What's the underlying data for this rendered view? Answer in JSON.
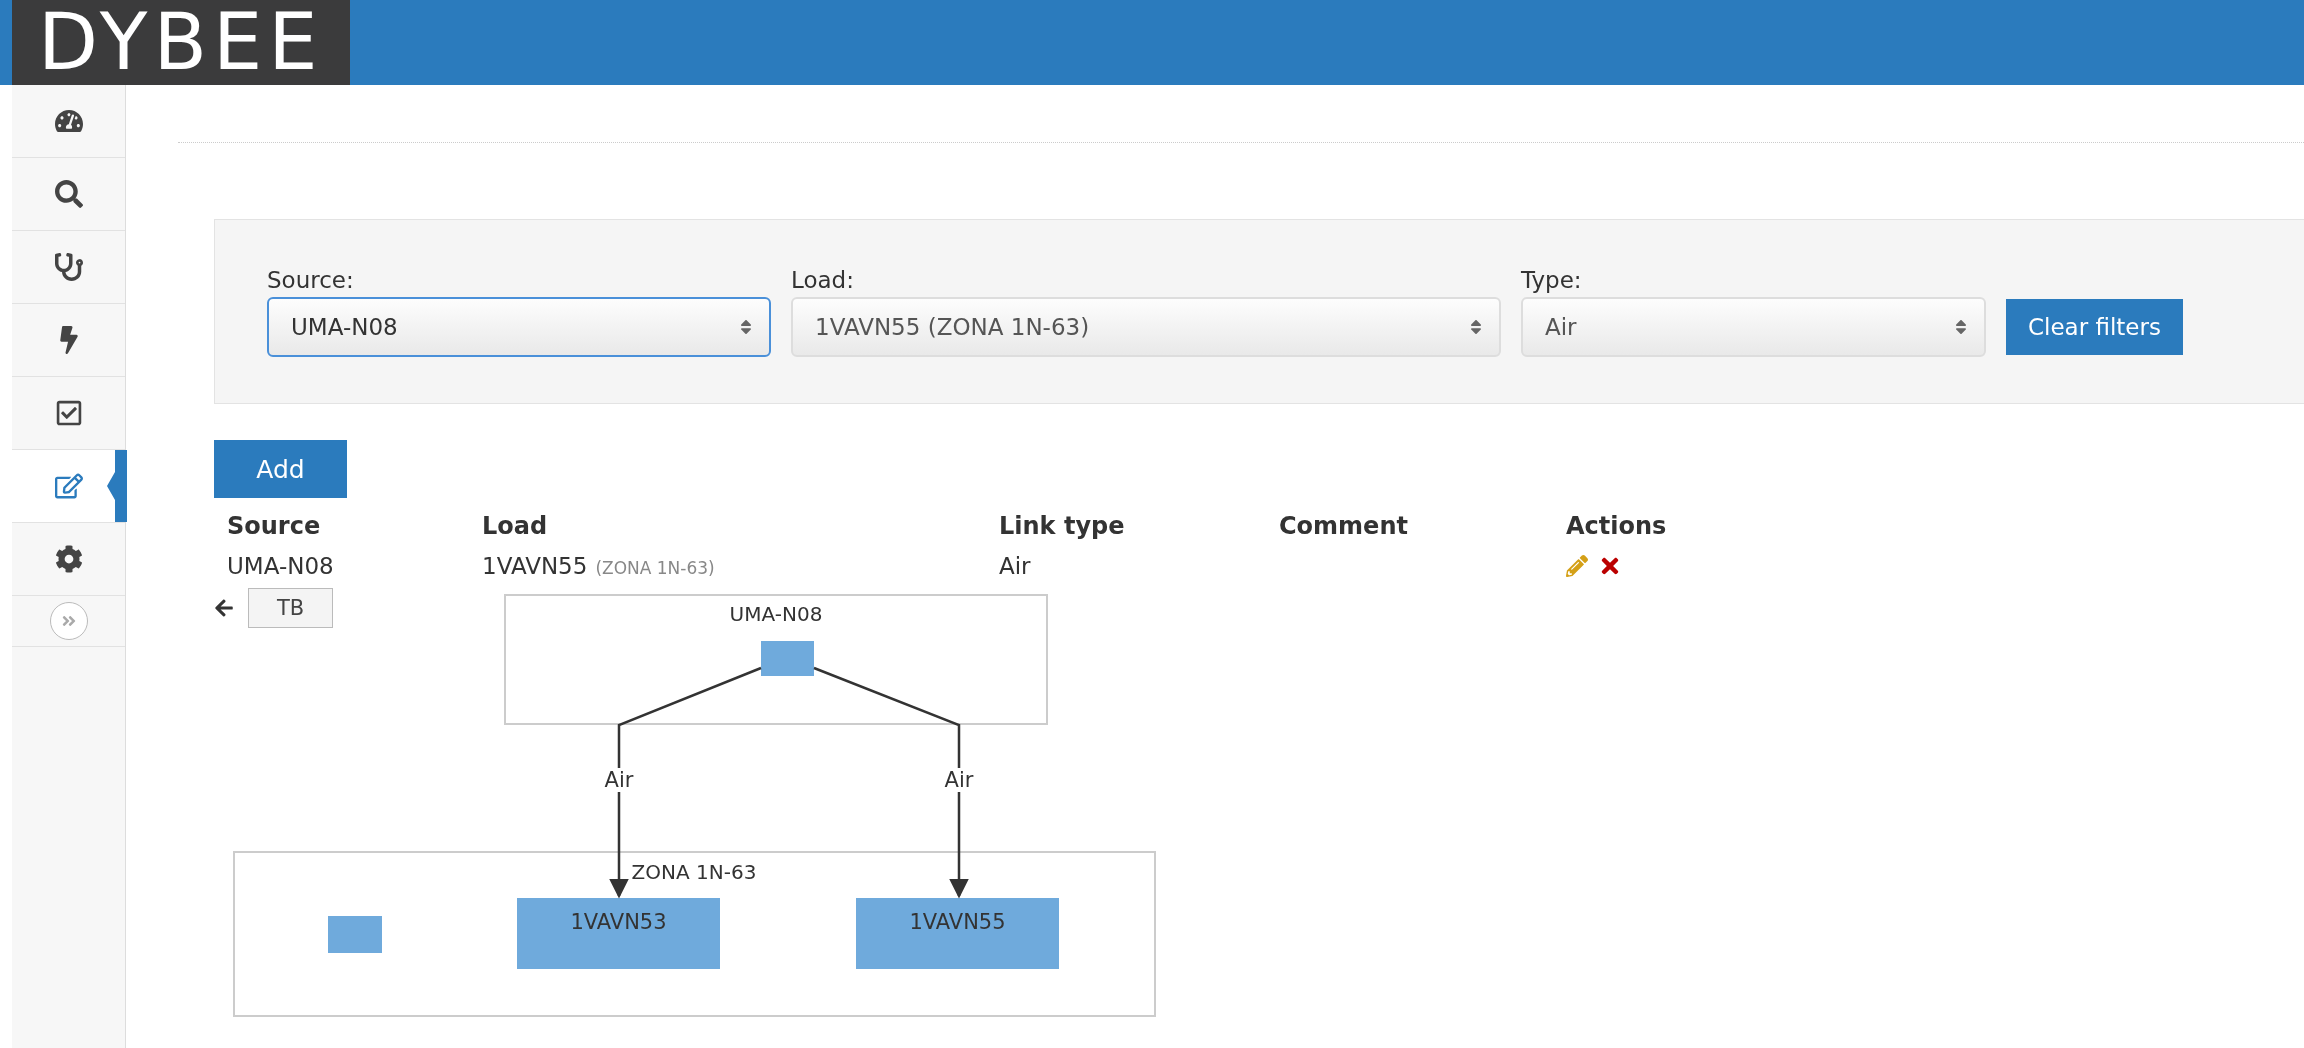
{
  "header": {
    "logo": "DYBEE"
  },
  "sidebar": {
    "items": [
      {
        "selected": false
      },
      {
        "selected": false
      },
      {
        "selected": false
      },
      {
        "selected": false
      },
      {
        "selected": false
      },
      {
        "selected": true
      },
      {
        "selected": false
      }
    ]
  },
  "filters": [
    {
      "label": "Source:",
      "value": "UMA-N08",
      "focused": true
    },
    {
      "label": "Load:",
      "value": "1VAVN55 (ZONA 1N-63)",
      "focused": false
    },
    {
      "label": "Type:",
      "value": "Air",
      "focused": false
    }
  ],
  "clear_button": "Clear filters",
  "add_button": "Add",
  "table": {
    "columns": [
      "Source",
      "Load",
      "Link type",
      "Comment",
      "Actions"
    ],
    "rows": [
      {
        "source": "UMA-N08",
        "load": "1VAVN55",
        "load_zone": "(ZONA 1N-63)",
        "link_type": "Air"
      }
    ]
  },
  "direction_toggle": "TB",
  "diagram": {
    "source_group": "UMA-N08",
    "target_group": "ZONA 1N-63",
    "nodes": [
      "1VAVN53",
      "1VAVN55"
    ],
    "edges": [
      {
        "label": "Air"
      },
      {
        "label": "Air"
      }
    ]
  }
}
